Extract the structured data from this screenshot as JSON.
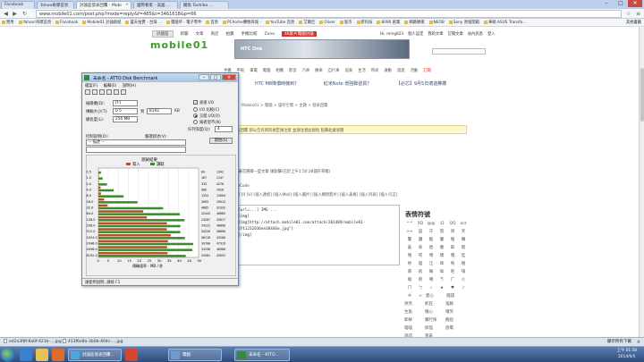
{
  "tabs": [
    {
      "label": "Facebook",
      "active": false
    },
    {
      "label": "Yahoo奇摩首頁",
      "active": false
    },
    {
      "label": "討論區發表回覆 - Mobi",
      "active": true
    },
    {
      "label": "國際看家 - 美國 ...",
      "active": false
    },
    {
      "label": "鱷魚 Toshiba ...",
      "active": false
    }
  ],
  "window_controls": {
    "minimize": "–",
    "maximize": "□",
    "close": "✕"
  },
  "address": {
    "url": "www.mobile01.com/post.php?mode=reply&f=485&t=3461618&p=66"
  },
  "bookmarks": [
    "實用",
    "Yahoo!奇摩首頁",
    "Facebook",
    "Mobile01 討論群組",
    "露天拍賣 - 台灣 ...",
    "電腦帝 - 電子零件",
    "首頁",
    "PChome購物商城 -",
    "YouTube 首頁",
    "艾爾佳",
    "Oliver",
    "股市",
    "新科技",
    "8090 創業",
    "網路硬碟",
    "NEOB",
    "Sony 原版開箱",
    "華碩 ASUS Transfo..."
  ],
  "bookmarks_other": "其他書籤",
  "site": {
    "nav": [
      "討論區",
      "新聞",
      "文章",
      "商店",
      "拍賣",
      "手機比較",
      "Zone",
      "4K影片電腦討論"
    ],
    "top_links": [
      "Hi, ming823",
      "個人設定",
      "我的文章",
      "訂閱文章",
      "站內訊息",
      "登入"
    ],
    "banner_text": "HTC One",
    "menu": [
      "手機",
      "平板",
      "筆電",
      "電腦",
      "相機",
      "影音",
      "汽車",
      "機車",
      "自行車",
      "居家",
      "生活",
      "時尚",
      "運動",
      "旅遊",
      "活動",
      "訂閱"
    ],
    "headlines": [
      "HTC M8降價時機到?",
      "紅米Note 增強聯發貨?",
      "【必芯】9月5日適遊推薦"
    ],
    "breadcrumbs": "Mobile01 > 電腦 > 儲存空間 > 主題 > 發表回覆",
    "notice": "發表回覆 即公告有新的規定請注意 並請注意此規則 點擊此處查閱",
    "line1": "這邊可選擇一些文章 請點擊(已於上午1:50:38儲存草稿)",
    "line2": "BBCode",
    "toolbar2": "[B] [I] [U] [插入連結] [插入Mail] [插入圖片] [插入網頁影片] [插入表格] [插入列表] [插入引言]",
    "editor_lines": [
      "[url=...] IMG ...",
      "[img]",
      "[img]http://attach.mobile01.com/attach/201409/mobile01-",
      "6f41232036ee30446e.jpg\"]",
      "[/img]"
    ],
    "emoji_title": "表情符號",
    "emoji": [
      "^^",
      "XD",
      "@@",
      ":D",
      "QQ",
      "orz",
      "><",
      "囧",
      "汗",
      "怒",
      "哭",
      "笑",
      "驚",
      "讚",
      "酷",
      "暈",
      "噓",
      "懶",
      "羞",
      "呆",
      "哈",
      "喔",
      "耶",
      "嗯",
      "咦",
      "哎",
      "嘿",
      "噗",
      "嘖",
      "哇",
      "呼",
      "喵",
      "汪",
      "咩",
      "嗚",
      "嘻",
      "厚",
      "吼",
      "嘛",
      "唉",
      "呸",
      "嗨",
      "嘔",
      "吧",
      "嘆",
      "ㄎ",
      "ㄏ",
      "ㄍ",
      "ㄇ",
      "ㄅ",
      "☆",
      "★",
      "♥",
      "♪",
      "※",
      "∞"
    ],
    "emoji_text": [
      "愛心",
      "錢錢",
      "哭笑",
      "抓狂",
      "鬼臉",
      "生氣",
      "傷心",
      "噴笑",
      "耶穌",
      "獨行俠",
      "翹屁",
      "喵喵",
      "搞怪",
      "放電",
      "說謊",
      "害羞"
    ]
  },
  "atto": {
    "title": "未命名 - ATTO Disk Benchmark",
    "menu": [
      "檔案(F)",
      "編輯(E)",
      "說明(H)"
    ],
    "drive_label": "磁碟機(D):",
    "drive_value": "[f-]",
    "transfer_label": "傳輸大小(T):",
    "transfer_from": "0.5",
    "transfer_to_label": "到",
    "transfer_to": "8192",
    "transfer_unit": "KB",
    "length_label": "總長度(L):",
    "length_value": "256 MB",
    "direct_io": "直接 I/O",
    "io_compare": "I/O 比較(C)",
    "overlapped": "交錯 I/O(O)",
    "neither": "兩者皆不(N)",
    "queue_label": "佇列深度(Q):",
    "queue_value": "4",
    "desc_label": "控制說明(D):",
    "desc_value": "-- 描述 --",
    "verify_label": "驗證敘述(V):",
    "start_button": "開始(S)",
    "results_title": "測試結果",
    "write_legend": "寫入",
    "read_legend": "讀取",
    "status": "請使用說明, 請按 F1"
  },
  "chart_data": {
    "type": "bar",
    "title": "測試結果",
    "xlabel": "傳輸速率 - MB / 秒",
    "xlim": [
      0,
      50
    ],
    "xticks": [
      0,
      5,
      10,
      15,
      20,
      25,
      30,
      35,
      40,
      45,
      50
    ],
    "categories": [
      "0.5",
      "1.0",
      "2.0",
      "4.0",
      "8.0",
      "16.0",
      "32.0",
      "64.0",
      "128.0",
      "256.0",
      "512.0",
      "1024.0",
      "2048.0",
      "4096.0",
      "8192.0"
    ],
    "series": [
      {
        "name": "寫入",
        "color": "#b5502a",
        "values": [
          0.1,
          0.2,
          0.3,
          1.1,
          1.3,
          2.9,
          4.6,
          22.4,
          24.2,
          34.2,
          34.2,
          36.1,
          34.7,
          34.3,
          34.5
        ]
      },
      {
        "name": "讀取",
        "color": "#3c8a2c",
        "values": [
          1.3,
          2.1,
          4.3,
          7.6,
          12.6,
          19.5,
          32.3,
          40.6,
          43.0,
          40.9,
          40.9,
          43.2,
          47.3,
          46.9,
          43.6
        ]
      }
    ],
    "write_text": [
      "84",
      "167",
      "333",
      "980",
      "1334",
      "2693",
      "4605",
      "22443",
      "24207",
      "34222",
      "34226",
      "36118",
      "34700",
      "34336",
      "34501"
    ],
    "read_text": [
      "1342",
      "2147",
      "4270",
      "7620",
      "12604",
      "19515",
      "32332",
      "40883",
      "43017",
      "40890",
      "40890",
      "43200",
      "47319",
      "46900",
      "43552"
    ]
  },
  "downloads": [
    {
      "label": "ed2a3f8f-8a0f-421b-....jpg"
    },
    {
      "label": "413f6e8a-3b0b-404c-....jpg"
    }
  ],
  "downloads_all": "顯示所有下載",
  "taskbar": {
    "tasks": [
      "討論區發表回覆...",
      "電腦",
      "未命名 - ATTO..."
    ],
    "time": "上午 01:58",
    "date": "2014/9/5"
  },
  "colors": {
    "write": "#b5502a",
    "read": "#3c8a2c",
    "accent": "#2f5f9e"
  }
}
